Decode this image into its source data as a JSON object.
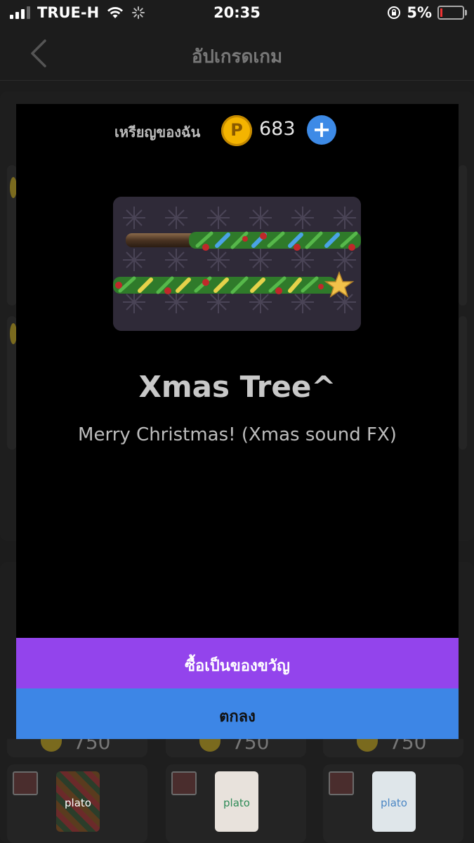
{
  "status_bar": {
    "carrier": "TRUE-H",
    "time": "20:35",
    "battery": "5%"
  },
  "nav": {
    "title": "อัปเกรดเกม"
  },
  "background": {
    "prices": [
      "750",
      "750",
      "750"
    ],
    "card_label": "plato"
  },
  "modal": {
    "coins_label": "เหรียญของฉัน",
    "coin_symbol": "P",
    "coins_value": "683",
    "plus_symbol": "+",
    "item_title": "Xmas Tree^",
    "item_description": "Merry Christmas! (Xmas sound FX)",
    "gift_button_label": "ซื้อเป็นของขวัญ",
    "ok_button_label": "ตกลง"
  },
  "colors": {
    "gift_button": "#9344ec",
    "ok_button": "#3d86e6",
    "coin": "#f4b400",
    "plus_button": "#3d8ae6"
  }
}
